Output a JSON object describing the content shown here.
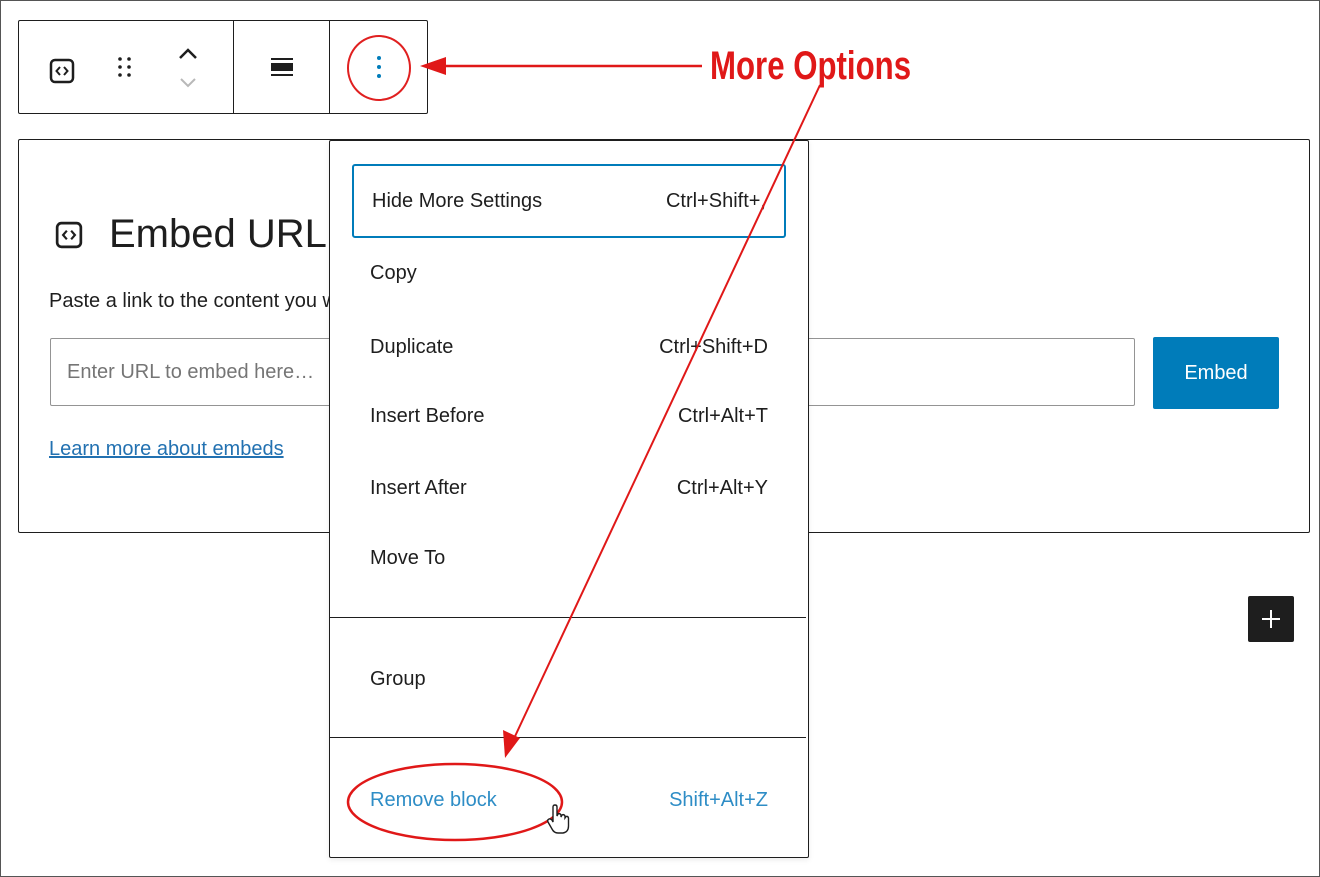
{
  "toolbar": {
    "embed_icon": "embed-icon",
    "drag_icon": "drag-handle-icon",
    "move_up_icon": "chevron-up-icon",
    "move_down_icon": "chevron-down-icon",
    "align_icon": "align-icon",
    "more_icon": "vertical-ellipsis-icon"
  },
  "block": {
    "title": "Embed URL",
    "instructions": "Paste a link to the content you want to display on your site.",
    "url_placeholder": "Enter URL to embed here…",
    "embed_button": "Embed",
    "learn_link": "Learn more about embeds"
  },
  "menu": {
    "items": [
      {
        "label": "Hide More Settings",
        "shortcut": "Ctrl+Shift+,"
      },
      {
        "label": "Copy",
        "shortcut": ""
      },
      {
        "label": "Duplicate",
        "shortcut": "Ctrl+Shift+D"
      },
      {
        "label": "Insert Before",
        "shortcut": "Ctrl+Alt+T"
      },
      {
        "label": "Insert After",
        "shortcut": "Ctrl+Alt+Y"
      },
      {
        "label": "Move To",
        "shortcut": ""
      }
    ],
    "group_label": "Group",
    "remove": {
      "label": "Remove block",
      "shortcut": "Shift+Alt+Z"
    }
  },
  "annotation": {
    "label": "More Options",
    "color": "#e01818"
  },
  "colors": {
    "accent": "#007cba",
    "text": "#1e1e1e",
    "annotation": "#e01818"
  }
}
